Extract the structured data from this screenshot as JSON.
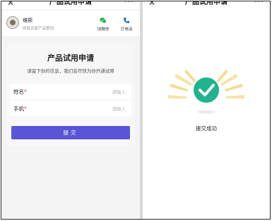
{
  "left": {
    "topbar": {
      "close": "✕",
      "title": "产品试用申请",
      "more": "···"
    },
    "contact": {
      "name": "维熙",
      "subtitle": "网易百家产品策划",
      "wechat_label": "加微信",
      "phone_label": "打电话"
    },
    "form": {
      "title": "产品试用申请",
      "description": "请留下你的信息，我们会尽快为你开通试用",
      "fields": [
        {
          "label": "姓名",
          "required": "*",
          "placeholder": "请输入"
        },
        {
          "label": "手机",
          "required": "*",
          "placeholder": "请输入"
        }
      ],
      "submit_label": "提交"
    }
  },
  "right": {
    "topbar": {
      "close": "✕",
      "title": "产品试用申请",
      "more": "···"
    },
    "success_text": "提交成功"
  },
  "colors": {
    "primary_button": "#5a55d6",
    "success_green": "#1fb48e",
    "required_red": "#e23b3b",
    "wechat_green": "#22b14c",
    "phone_blue": "#2a6fd6",
    "rays_yellow": "#f5dc8f"
  }
}
